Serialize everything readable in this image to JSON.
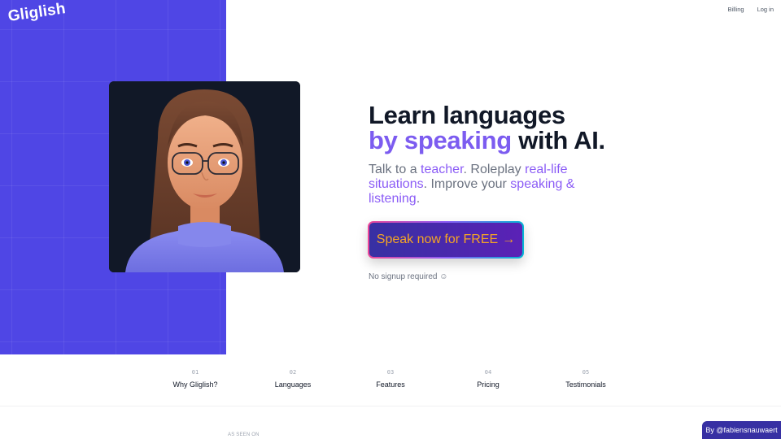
{
  "brand": {
    "logo": "Gliglish",
    "panel_color": "#4f46e5"
  },
  "top_nav": {
    "billing": "Billing",
    "login": "Log in"
  },
  "avatar": {
    "alt": "AI teacher avatar"
  },
  "hero": {
    "line1": "Learn languages",
    "line2_accent": "by speaking",
    "line2_rest": " with AI.",
    "subtitle": {
      "p1": "Talk to a ",
      "h1": "teacher",
      "p2": ". Roleplay ",
      "h2": "real-life situations",
      "p3": ". Improve your ",
      "h3": "speaking & listening",
      "p4": "."
    }
  },
  "cta": {
    "label": "Speak now for FREE",
    "arrow": "→"
  },
  "no_signup": {
    "label": "No signup required",
    "icon": "☺"
  },
  "sections": [
    {
      "num": "01",
      "label": "Why Gliglish?"
    },
    {
      "num": "02",
      "label": "Languages"
    },
    {
      "num": "03",
      "label": "Features"
    },
    {
      "num": "04",
      "label": "Pricing"
    },
    {
      "num": "05",
      "label": "Testimonials"
    }
  ],
  "as_seen_on": "AS SEEN ON",
  "author_badge": "By @fabiensnauwaert"
}
